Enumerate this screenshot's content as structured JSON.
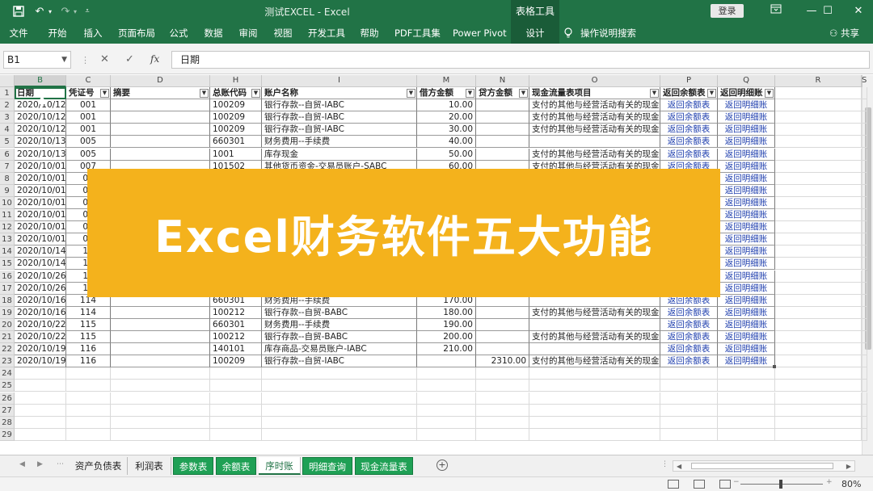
{
  "titlebar": {
    "title": "测试EXCEL - Excel",
    "context_tab": "表格工具",
    "login": "登录",
    "icons": [
      "save-icon",
      "undo-icon",
      "redo-icon",
      "customize-icon",
      "ribbon-display-icon",
      "minimize-icon",
      "maximize-icon",
      "close-icon"
    ]
  },
  "ribbon": {
    "tabs": [
      "文件",
      "开始",
      "插入",
      "页面布局",
      "公式",
      "数据",
      "审阅",
      "视图",
      "开发工具",
      "帮助",
      "PDF工具集",
      "Power Pivot",
      "设计"
    ],
    "tell_me": "操作说明搜索",
    "share": "共享"
  },
  "formula_bar": {
    "name_box": "B1",
    "cancel": "✕",
    "enter": "✓",
    "fx": "fx",
    "value": "日期"
  },
  "grid": {
    "selected_cell": "B1",
    "column_letters": [
      "B",
      "C",
      "D",
      "H",
      "I",
      "M",
      "N",
      "O",
      "P",
      "Q",
      "R",
      "S"
    ],
    "row_numbers": [
      "1",
      "2",
      "3",
      "4",
      "5",
      "6",
      "7",
      "8",
      "9",
      "10",
      "11",
      "12",
      "13",
      "14",
      "15",
      "16",
      "17",
      "18",
      "19",
      "20",
      "21",
      "22",
      "23",
      "24",
      "25",
      "26",
      "27",
      "28",
      "29"
    ],
    "headers": [
      "日期",
      "凭证号",
      "摘要",
      "总账代码",
      "账户名称",
      "借方金额",
      "贷方金额",
      "现金流量表项目",
      "返回余额表",
      "返回明细账"
    ],
    "rows": [
      [
        "2020/10/12",
        "001",
        "",
        "100209",
        "银行存款--自贸-IABC",
        "10.00",
        "",
        "支付的其他与经营活动有关的现金",
        "返回余额表",
        "返回明细账"
      ],
      [
        "2020/10/12",
        "001",
        "",
        "100209",
        "银行存款--自贸-IABC",
        "20.00",
        "",
        "支付的其他与经营活动有关的现金",
        "返回余额表",
        "返回明细账"
      ],
      [
        "2020/10/12",
        "001",
        "",
        "100209",
        "银行存款--自贸-IABC",
        "30.00",
        "",
        "支付的其他与经营活动有关的现金",
        "返回余额表",
        "返回明细账"
      ],
      [
        "2020/10/13",
        "005",
        "",
        "660301",
        "财务费用--手续费",
        "40.00",
        "",
        "",
        "返回余额表",
        "返回明细账"
      ],
      [
        "2020/10/13",
        "005",
        "",
        "1001",
        "库存现金",
        "50.00",
        "",
        "支付的其他与经营活动有关的现金",
        "返回余额表",
        "返回明细账"
      ],
      [
        "2020/10/01",
        "007",
        "",
        "101502",
        "其他货币资金-交易员账户-SABC",
        "60.00",
        "",
        "支付的其他与经营活动有关的现金",
        "返回余额表",
        "返回明细账"
      ],
      [
        "2020/10/01",
        "00",
        "",
        "",
        "",
        "",
        "",
        "",
        "返回余额表",
        "返回明细账"
      ],
      [
        "2020/10/01",
        "00",
        "",
        "",
        "",
        "",
        "",
        "",
        "返回余额表",
        "返回明细账"
      ],
      [
        "2020/10/01",
        "00",
        "",
        "",
        "",
        "",
        "",
        "",
        "返回余额表",
        "返回明细账"
      ],
      [
        "2020/10/01",
        "00",
        "",
        "",
        "",
        "",
        "",
        "",
        "返回余额表",
        "返回明细账"
      ],
      [
        "2020/10/01",
        "00",
        "",
        "",
        "",
        "",
        "",
        "",
        "返回余额表",
        "返回明细账"
      ],
      [
        "2020/10/01",
        "00",
        "",
        "",
        "",
        "",
        "",
        "",
        "返回余额表",
        "返回明细账"
      ],
      [
        "2020/10/14",
        "11",
        "",
        "",
        "",
        "",
        "",
        "",
        "返回余额表",
        "返回明细账"
      ],
      [
        "2020/10/14",
        "11",
        "",
        "",
        "",
        "",
        "",
        "",
        "返回余额表",
        "返回明细账"
      ],
      [
        "2020/10/26",
        "11",
        "",
        "",
        "",
        "",
        "",
        "",
        "返回余额表",
        "返回明细账"
      ],
      [
        "2020/10/26",
        "11",
        "",
        "",
        "",
        "",
        "",
        "",
        "返回余额表",
        "返回明细账"
      ],
      [
        "2020/10/16",
        "114",
        "",
        "660301",
        "财务费用--手续费",
        "170.00",
        "",
        "",
        "返回余额表",
        "返回明细账"
      ],
      [
        "2020/10/16",
        "114",
        "",
        "100212",
        "银行存款--自贸-BABC",
        "180.00",
        "",
        "支付的其他与经营活动有关的现金",
        "返回余额表",
        "返回明细账"
      ],
      [
        "2020/10/22",
        "115",
        "",
        "660301",
        "财务费用--手续费",
        "190.00",
        "",
        "",
        "返回余额表",
        "返回明细账"
      ],
      [
        "2020/10/22",
        "115",
        "",
        "100212",
        "银行存款--自贸-BABC",
        "200.00",
        "",
        "支付的其他与经营活动有关的现金",
        "返回余额表",
        "返回明细账"
      ],
      [
        "2020/10/19",
        "116",
        "",
        "140101",
        "库存商品-交易员账户-IABC",
        "210.00",
        "",
        "",
        "返回余额表",
        "返回明细账"
      ],
      [
        "2020/10/19",
        "116",
        "",
        "100209",
        "银行存款--自贸-IABC",
        "",
        "2310.00",
        "支付的其他与经营活动有关的现金",
        "返回余额表",
        "返回明细账"
      ]
    ]
  },
  "banner": {
    "text": "Excel财务软件五大功能",
    "color": "#f4b21c"
  },
  "sheet_tabs": {
    "tabs": [
      {
        "label": "资产负债表",
        "style": "plain"
      },
      {
        "label": "利润表",
        "style": "plain"
      },
      {
        "label": "参数表",
        "style": "green"
      },
      {
        "label": "余额表",
        "style": "green"
      },
      {
        "label": "序时账",
        "style": "active"
      },
      {
        "label": "明细查询",
        "style": "green"
      },
      {
        "label": "现金流量表",
        "style": "green"
      }
    ],
    "add_sheet": "+"
  },
  "statusbar": {
    "zoom_level": "80%",
    "views": [
      "normal-view-icon",
      "page-layout-icon",
      "page-break-icon"
    ]
  },
  "colors": {
    "excel_green": "#217346",
    "sheet_tab_green": "#1fa055",
    "link_blue": "#1f3fae"
  }
}
